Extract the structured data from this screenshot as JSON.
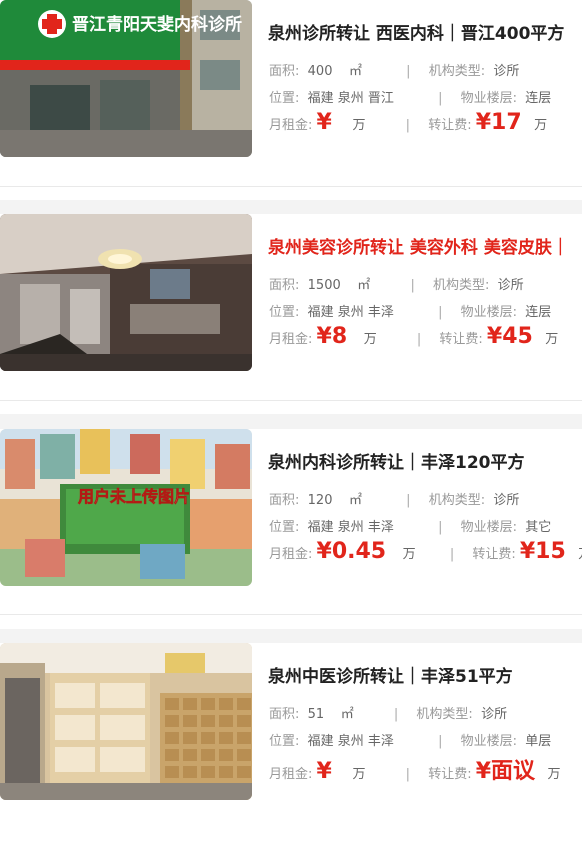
{
  "listings": [
    {
      "title": "泉州诊所转让 西医内科｜晋江400平方",
      "title_red": false,
      "area_label": "面积:",
      "area_value": "400",
      "area_unit": "㎡",
      "type_label": "机构类型:",
      "type_value": "诊所",
      "loc_label": "位置:",
      "loc_value": "福建 泉州 晋江",
      "floor_label": "物业楼层:",
      "floor_value": "连层",
      "rent_label": "月租金:",
      "rent_value": "¥",
      "rent_unit": "万",
      "fee_label": "转让费:",
      "fee_value": "¥17",
      "fee_unit": "万",
      "sign_text": "晋江青阳天斐内科诊所"
    },
    {
      "title": "泉州美容诊所转让 美容外科 美容皮肤｜",
      "title_red": true,
      "area_label": "面积:",
      "area_value": "1500",
      "area_unit": "㎡",
      "type_label": "机构类型:",
      "type_value": "诊所",
      "loc_label": "位置:",
      "loc_value": "福建 泉州 丰泽",
      "floor_label": "物业楼层:",
      "floor_value": "连层",
      "rent_label": "月租金:",
      "rent_value": "¥8",
      "rent_unit": "万",
      "fee_label": "转让费:",
      "fee_value": "¥45",
      "fee_unit": "万"
    },
    {
      "title": "泉州内科诊所转让｜丰泽120平方",
      "title_red": false,
      "area_label": "面积:",
      "area_value": "120",
      "area_unit": "㎡",
      "type_label": "机构类型:",
      "type_value": "诊所",
      "loc_label": "位置:",
      "loc_value": "福建 泉州 丰泽",
      "floor_label": "物业楼层:",
      "floor_value": "其它",
      "rent_label": "月租金:",
      "rent_value": "¥0.45",
      "rent_unit": "万",
      "fee_label": "转让费:",
      "fee_value": "¥15",
      "fee_unit": "万",
      "placeholder_text": "用户未上传图片"
    },
    {
      "title": "泉州中医诊所转让｜丰泽51平方",
      "title_red": false,
      "area_label": "面积:",
      "area_value": "51",
      "area_unit": "㎡",
      "type_label": "机构类型:",
      "type_value": "诊所",
      "loc_label": "位置:",
      "loc_value": "福建 泉州 丰泽",
      "floor_label": "物业楼层:",
      "floor_value": "单层",
      "rent_label": "月租金:",
      "rent_value": "¥",
      "rent_unit": "万",
      "fee_label": "转让费:",
      "fee_value": "¥面议",
      "fee_unit": "万"
    }
  ],
  "colors": {
    "price": "#e1251b",
    "title": "#222222",
    "label": "#999999"
  }
}
